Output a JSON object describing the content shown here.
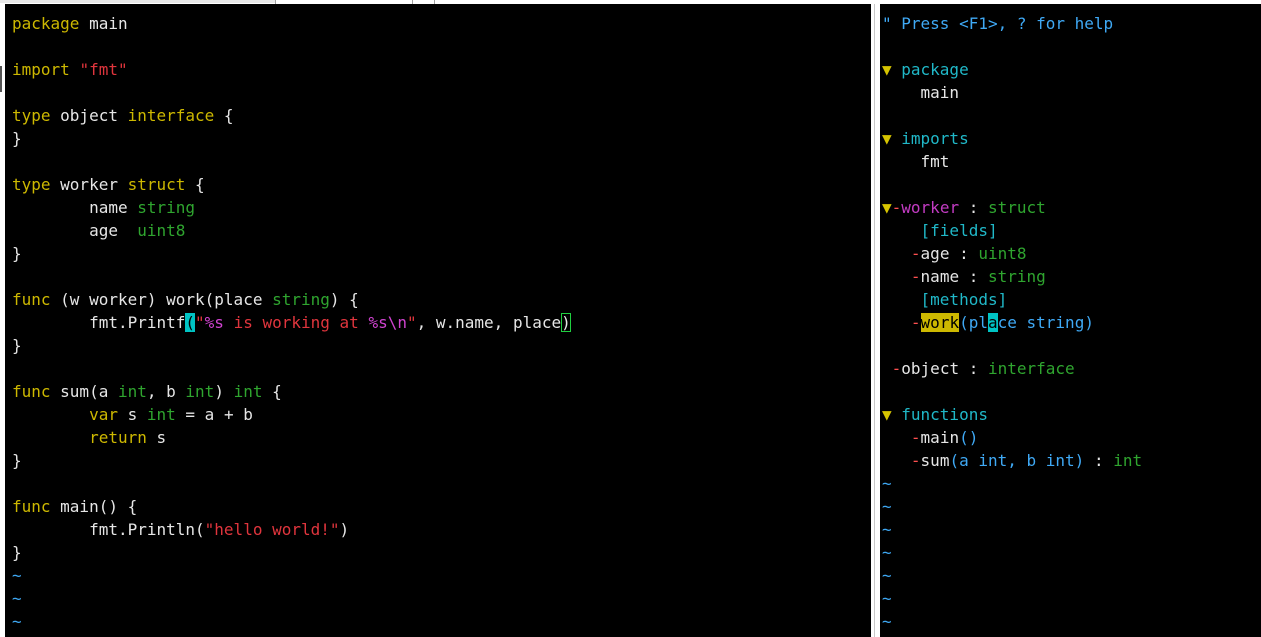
{
  "editor": {
    "code_lines": [
      [
        {
          "t": "package",
          "c": "kw"
        },
        {
          "t": " main",
          "c": "tx"
        }
      ],
      [],
      [
        {
          "t": "import",
          "c": "kw"
        },
        {
          "t": " ",
          "c": "tx"
        },
        {
          "t": "\"fmt\"",
          "c": "st"
        }
      ],
      [],
      [
        {
          "t": "type",
          "c": "kw"
        },
        {
          "t": " object ",
          "c": "tx"
        },
        {
          "t": "interface",
          "c": "kw"
        },
        {
          "t": " {",
          "c": "tx"
        }
      ],
      [
        {
          "t": "}",
          "c": "tx"
        }
      ],
      [],
      [
        {
          "t": "type",
          "c": "kw"
        },
        {
          "t": " worker ",
          "c": "tx"
        },
        {
          "t": "struct",
          "c": "kw"
        },
        {
          "t": " {",
          "c": "tx"
        }
      ],
      [
        {
          "t": "        name ",
          "c": "tx"
        },
        {
          "t": "string",
          "c": "ty"
        }
      ],
      [
        {
          "t": "        age  ",
          "c": "tx"
        },
        {
          "t": "uint8",
          "c": "ty"
        }
      ],
      [
        {
          "t": "}",
          "c": "tx"
        }
      ],
      [],
      [
        {
          "t": "func",
          "c": "kw"
        },
        {
          "t": " (w worker) work(place ",
          "c": "tx"
        },
        {
          "t": "string",
          "c": "ty"
        },
        {
          "t": ") {",
          "c": "tx"
        }
      ],
      [
        {
          "t": "        fmt.Printf",
          "c": "tx"
        },
        {
          "t": "(",
          "c": "paren-hl"
        },
        {
          "t": "\"",
          "c": "st"
        },
        {
          "t": "%s",
          "c": "esc"
        },
        {
          "t": " is working at ",
          "c": "st"
        },
        {
          "t": "%s",
          "c": "esc"
        },
        {
          "t": "\\n",
          "c": "esc"
        },
        {
          "t": "\"",
          "c": "st"
        },
        {
          "t": ", w.name, place",
          "c": "tx"
        },
        {
          "t": ")",
          "c": "tx paren-box"
        }
      ],
      [
        {
          "t": "}",
          "c": "tx"
        }
      ],
      [],
      [
        {
          "t": "func",
          "c": "kw"
        },
        {
          "t": " sum(a ",
          "c": "tx"
        },
        {
          "t": "int",
          "c": "ty"
        },
        {
          "t": ", b ",
          "c": "tx"
        },
        {
          "t": "int",
          "c": "ty"
        },
        {
          "t": ") ",
          "c": "tx"
        },
        {
          "t": "int",
          "c": "ty"
        },
        {
          "t": " {",
          "c": "tx"
        }
      ],
      [
        {
          "t": "        ",
          "c": "tx"
        },
        {
          "t": "var",
          "c": "kw"
        },
        {
          "t": " s ",
          "c": "tx"
        },
        {
          "t": "int",
          "c": "ty"
        },
        {
          "t": " = a + b",
          "c": "tx"
        }
      ],
      [
        {
          "t": "        ",
          "c": "tx"
        },
        {
          "t": "return",
          "c": "kw"
        },
        {
          "t": " s",
          "c": "tx"
        }
      ],
      [
        {
          "t": "}",
          "c": "tx"
        }
      ],
      [],
      [
        {
          "t": "func",
          "c": "kw"
        },
        {
          "t": " main() {",
          "c": "tx"
        }
      ],
      [
        {
          "t": "        fmt.Println(",
          "c": "tx"
        },
        {
          "t": "\"hello world!\"",
          "c": "st"
        },
        {
          "t": ")",
          "c": "tx"
        }
      ],
      [
        {
          "t": "}",
          "c": "tx"
        }
      ],
      [
        {
          "t": "~",
          "c": "tilde"
        }
      ],
      [
        {
          "t": "~",
          "c": "tilde"
        }
      ],
      [
        {
          "t": "~",
          "c": "tilde"
        }
      ]
    ]
  },
  "tagbar": {
    "lines": [
      [
        {
          "t": "\" Press <F1>, ? for help",
          "c": "t-help"
        }
      ],
      [],
      [
        {
          "t": "▼ ",
          "c": "t-fold"
        },
        {
          "t": "package",
          "c": "t-head"
        }
      ],
      [
        {
          "t": "    main",
          "c": "tx"
        }
      ],
      [],
      [
        {
          "t": "▼ ",
          "c": "t-fold"
        },
        {
          "t": "imports",
          "c": "t-head"
        }
      ],
      [
        {
          "t": "    fmt",
          "c": "tx"
        }
      ],
      [],
      [
        {
          "t": "▼",
          "c": "t-fold"
        },
        {
          "t": "-",
          "c": "t-vis"
        },
        {
          "t": "worker",
          "c": "t-mag"
        },
        {
          "t": " : ",
          "c": "tx"
        },
        {
          "t": "struct",
          "c": "ty"
        }
      ],
      [
        {
          "t": "    [fields]",
          "c": "t-head"
        }
      ],
      [
        {
          "t": "   ",
          "c": "tx"
        },
        {
          "t": "-",
          "c": "t-vis"
        },
        {
          "t": "age : ",
          "c": "tx"
        },
        {
          "t": "uint8",
          "c": "ty"
        }
      ],
      [
        {
          "t": "   ",
          "c": "tx"
        },
        {
          "t": "-",
          "c": "t-vis"
        },
        {
          "t": "name : ",
          "c": "tx"
        },
        {
          "t": "string",
          "c": "ty"
        }
      ],
      [
        {
          "t": "    [methods]",
          "c": "t-head"
        }
      ],
      [
        {
          "t": "   ",
          "c": "tx"
        },
        {
          "t": "-",
          "c": "t-vis"
        },
        {
          "t": "work",
          "c": "t-work"
        },
        {
          "t": "(pl",
          "c": "t-blue"
        },
        {
          "t": "a",
          "c": "t-cur"
        },
        {
          "t": "ce string)",
          "c": "t-blue"
        }
      ],
      [],
      [
        {
          "t": " ",
          "c": "tx"
        },
        {
          "t": "-",
          "c": "t-vis"
        },
        {
          "t": "object : ",
          "c": "tx"
        },
        {
          "t": "interface",
          "c": "ty"
        }
      ],
      [],
      [
        {
          "t": "▼ ",
          "c": "t-fold"
        },
        {
          "t": "functions",
          "c": "t-head"
        }
      ],
      [
        {
          "t": "   ",
          "c": "tx"
        },
        {
          "t": "-",
          "c": "t-vis"
        },
        {
          "t": "main",
          "c": "tx"
        },
        {
          "t": "()",
          "c": "t-blue"
        }
      ],
      [
        {
          "t": "   ",
          "c": "tx"
        },
        {
          "t": "-",
          "c": "t-vis"
        },
        {
          "t": "sum",
          "c": "tx"
        },
        {
          "t": "(a int, b int)",
          "c": "t-blue"
        },
        {
          "t": " : ",
          "c": "tx"
        },
        {
          "t": "int",
          "c": "ty"
        }
      ],
      [
        {
          "t": "~",
          "c": "tilde"
        }
      ],
      [
        {
          "t": "~",
          "c": "tilde"
        }
      ],
      [
        {
          "t": "~",
          "c": "tilde"
        }
      ],
      [
        {
          "t": "~",
          "c": "tilde"
        }
      ],
      [
        {
          "t": "~",
          "c": "tilde"
        }
      ],
      [
        {
          "t": "~",
          "c": "tilde"
        }
      ],
      [
        {
          "t": "~",
          "c": "tilde"
        }
      ]
    ]
  }
}
